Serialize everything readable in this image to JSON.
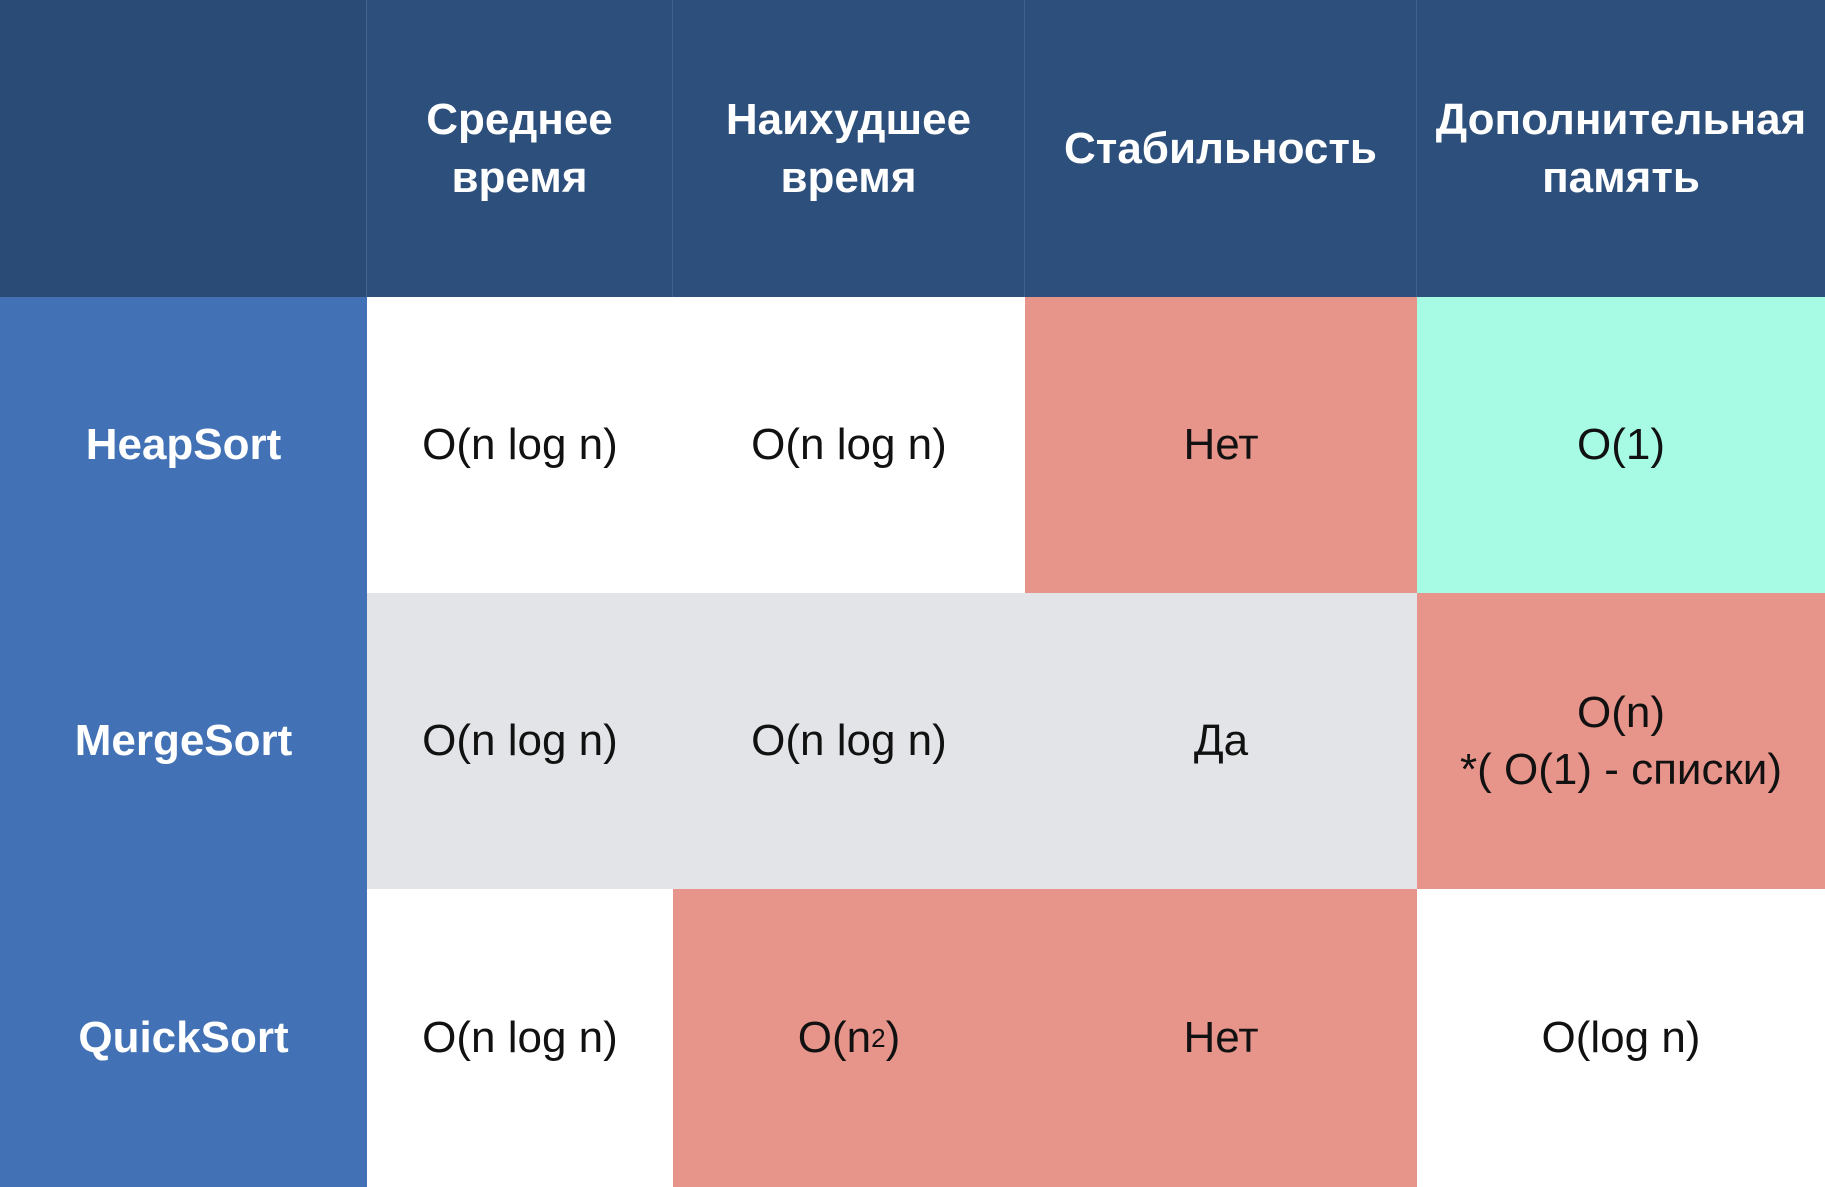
{
  "table": {
    "headers": {
      "corner": "",
      "avg_time_line1": "Среднее",
      "avg_time_line2": "время",
      "worst_time_line1": "Наихудшее",
      "worst_time_line2": "время",
      "stability": "Стабильность",
      "memory_line1": "Дополнительная",
      "memory_line2": "память"
    },
    "rows": [
      {
        "name": "HeapSort",
        "avg": "O(n log n)",
        "worst": "O(n log n)",
        "stable": "Нет",
        "memory": "O(1)"
      },
      {
        "name": "MergeSort",
        "avg": "O(n log n)",
        "worst": "O(n log n)",
        "stable": "Да",
        "memory_line1": "O(n)",
        "memory_line2": "*( O(1) - списки)"
      },
      {
        "name": "QuickSort",
        "avg": "O(n log n)",
        "worst_base": "O(n",
        "worst_exp": "2",
        "worst_close": ")",
        "stable": "Нет",
        "memory": "O(log n)"
      }
    ]
  },
  "colors": {
    "header_bg": "#2d4f7c",
    "row_header_bg": "#4272b5",
    "bad_bg": "#e7948b",
    "good_bg": "#a7fbe5",
    "neutral_row_bg": "#e3e4e8"
  }
}
